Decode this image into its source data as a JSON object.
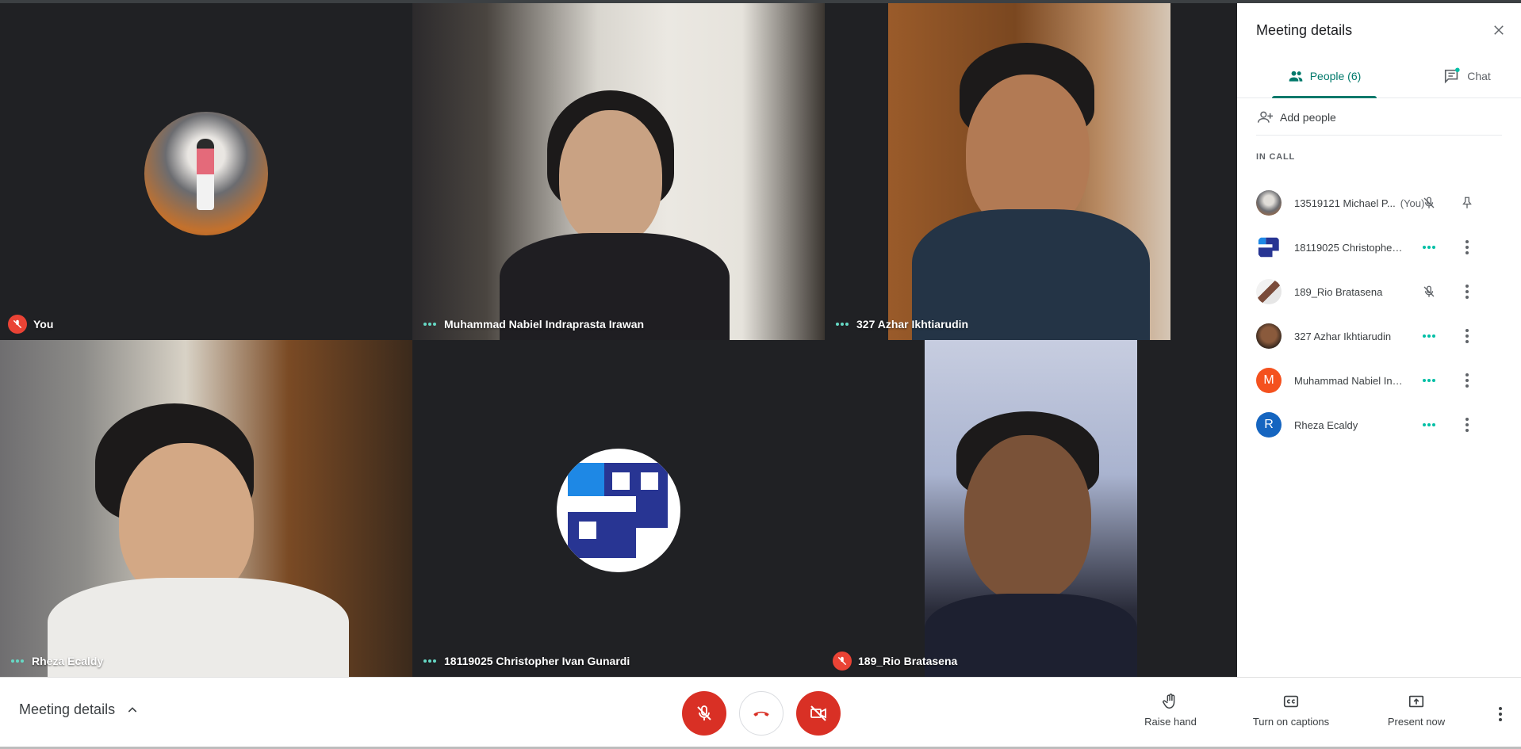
{
  "colors": {
    "accent_teal": "#00796b",
    "danger_red": "#d93025",
    "tile_bg": "#202124"
  },
  "tiles": [
    {
      "name": "You",
      "status_icon": "mic-off-icon",
      "display": "avatar-photo"
    },
    {
      "name": "Muhammad Nabiel Indraprasta Irawan",
      "status_icon": "speaking-dots-icon",
      "display": "video"
    },
    {
      "name": "327 Azhar Ikhtiarudin",
      "status_icon": "speaking-dots-icon",
      "display": "video"
    },
    {
      "name": "Rheza Ecaldy",
      "status_icon": "speaking-dots-icon",
      "display": "video"
    },
    {
      "name": "18119025 Christopher Ivan Gunardi",
      "status_icon": "speaking-dots-icon",
      "display": "avatar-logo"
    },
    {
      "name": "189_Rio Bratasena",
      "status_icon": "mic-off-icon",
      "display": "video"
    }
  ],
  "panel": {
    "title": "Meeting details",
    "close_icon": "close-icon",
    "tabs": {
      "people": "People (6)",
      "chat": "Chat"
    },
    "add_people": "Add people",
    "section_label": "IN CALL",
    "participants": [
      {
        "name": "13519121 Michael P...",
        "suffix": "(You)",
        "avatar": "photo",
        "action1": "mic-off-icon",
        "action2": "pin-icon"
      },
      {
        "name": "18119025 Christopher Iva...",
        "avatar": "logo",
        "action1": "speaking-dots-icon",
        "action2": "more-vert-icon"
      },
      {
        "name": "189_Rio Bratasena",
        "avatar": "photo",
        "action1": "mic-off-icon",
        "action2": "more-vert-icon"
      },
      {
        "name": "327 Azhar Ikhtiarudin",
        "avatar": "photo",
        "action1": "speaking-dots-icon",
        "action2": "more-vert-icon"
      },
      {
        "name": "Muhammad Nabiel Indra...",
        "avatar": "letter",
        "letter": "M",
        "avatar_color": "#f4511e",
        "action1": "speaking-dots-icon",
        "action2": "more-vert-icon"
      },
      {
        "name": "Rheza Ecaldy",
        "avatar": "letter",
        "letter": "R",
        "avatar_color": "#1565c0",
        "action1": "speaking-dots-icon",
        "action2": "more-vert-icon"
      }
    ]
  },
  "bottom_bar": {
    "meeting_details": "Meeting details",
    "raise_hand": "Raise hand",
    "captions": "Turn on captions",
    "present": "Present now"
  }
}
